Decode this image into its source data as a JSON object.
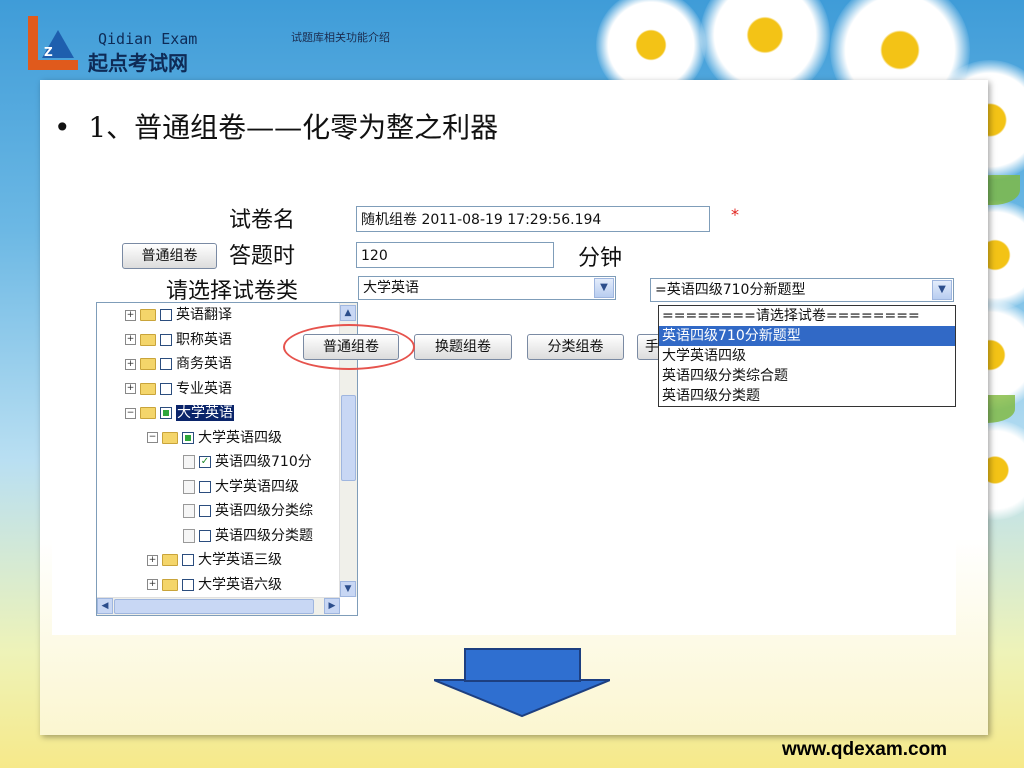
{
  "header": {
    "logo_en": "Qidian Exam",
    "logo_cn": "起点考试网",
    "note": "试题库相关功能介绍"
  },
  "slide": {
    "bullet": "1、普通组卷——化零为整之利器"
  },
  "form": {
    "name_label": "试卷名",
    "name_value": "随机组卷  2011-08-19 17:29:56.194",
    "required_mark": "*",
    "time_label": "答题时",
    "time_value": "120",
    "time_unit": "分钟",
    "category_label": "请选择试卷类",
    "category_value": "大学英语",
    "paper_select_value": "=英语四级710分新题型",
    "side_button": "普通组卷"
  },
  "toolbar": {
    "buttons": [
      "普通组卷",
      "换题组卷",
      "分类组卷",
      "手"
    ]
  },
  "tree": {
    "items": [
      {
        "label": "英语翻译",
        "level": 0,
        "checked": false,
        "expanded": false
      },
      {
        "label": "职称英语",
        "level": 0,
        "checked": false,
        "expanded": false
      },
      {
        "label": "商务英语",
        "level": 0,
        "checked": false,
        "expanded": false
      },
      {
        "label": "专业英语",
        "level": 0,
        "checked": false,
        "expanded": false
      },
      {
        "label": "大学英语",
        "level": 0,
        "checked": "partial",
        "expanded": true,
        "selected": true
      },
      {
        "label": "大学英语四级",
        "level": 1,
        "checked": "partial",
        "expanded": true
      },
      {
        "label": "英语四级710分",
        "level": 2,
        "checked": true
      },
      {
        "label": "大学英语四级",
        "level": 2,
        "checked": false
      },
      {
        "label": "英语四级分类综",
        "level": 2,
        "checked": false
      },
      {
        "label": "英语四级分类题",
        "level": 2,
        "checked": false
      },
      {
        "label": "大学英语三级",
        "level": 1,
        "checked": false,
        "expanded": false
      },
      {
        "label": "大学英语六级",
        "level": 1,
        "checked": false,
        "expanded": false
      }
    ]
  },
  "dropdown": {
    "options": [
      "========请选择试卷========",
      "英语四级710分新题型",
      "大学英语四级",
      "英语四级分类综合题",
      "英语四级分类题"
    ],
    "active_index": 1
  },
  "footer": {
    "url": "www.qdexam.com"
  },
  "colors": {
    "accent": "#3169c6",
    "required": "#e0201a",
    "arrow": "#2f6fd0"
  }
}
